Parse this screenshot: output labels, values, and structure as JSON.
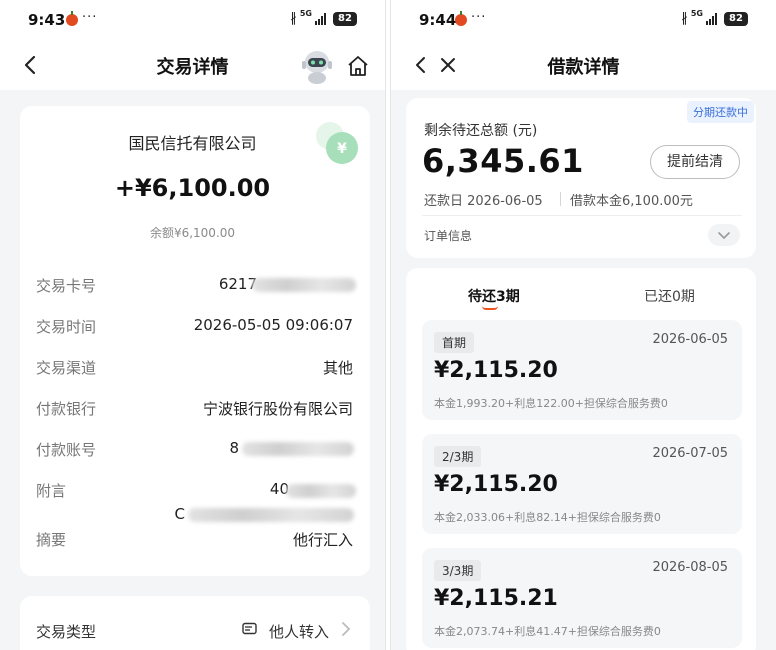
{
  "left": {
    "status": {
      "time": "9:43",
      "dots": "···",
      "network": "5G",
      "battery": "82"
    },
    "nav": {
      "title": "交易详情"
    },
    "summary": {
      "company": "国民信托有限公司",
      "amount": "+¥6,100.00",
      "balance": "余额¥6,100.00"
    },
    "details": [
      {
        "label": "交易卡号",
        "value": "6217"
      },
      {
        "label": "交易时间",
        "value": "2026-05-05 09:06:07"
      },
      {
        "label": "交易渠道",
        "value": "其他"
      },
      {
        "label": "付款银行",
        "value": "宁波银行股份有限公司"
      },
      {
        "label": "付款账号",
        "value": "8"
      },
      {
        "label": "附言",
        "value": "40",
        "value2": "C"
      },
      {
        "label": "摘要",
        "value": "他行汇入"
      }
    ],
    "type_row": {
      "label": "交易类型",
      "value": "他人转入"
    }
  },
  "right": {
    "status": {
      "time": "9:44",
      "dots": "···",
      "network": "5G",
      "battery": "82"
    },
    "nav": {
      "title": "借款详情"
    },
    "summary": {
      "badge": "分期还款中",
      "label": "剩余待还总额 (元)",
      "amount": "6,345.61",
      "prepay_button": "提前结清",
      "due_date": "还款日 2026-06-05",
      "principal": "借款本金6,100.00元",
      "order_info": "订单信息"
    },
    "tabs": [
      {
        "label": "待还3期",
        "active": true
      },
      {
        "label": "已还0期",
        "active": false
      }
    ],
    "installments": [
      {
        "tag": "首期",
        "date": "2026-06-05",
        "amount": "¥2,115.20",
        "detail": "本金1,993.20+利息122.00+担保综合服务费0"
      },
      {
        "tag": "2/3期",
        "date": "2026-07-05",
        "amount": "¥2,115.20",
        "detail": "本金2,033.06+利息82.14+担保综合服务费0"
      },
      {
        "tag": "3/3期",
        "date": "2026-08-05",
        "amount": "¥2,115.21",
        "detail": "本金2,073.74+利息41.47+担保综合服务费0"
      }
    ]
  },
  "colors": {
    "accent": "#f0541e",
    "badge_text": "#3a6fd8",
    "coin": "#8fd3a6"
  }
}
